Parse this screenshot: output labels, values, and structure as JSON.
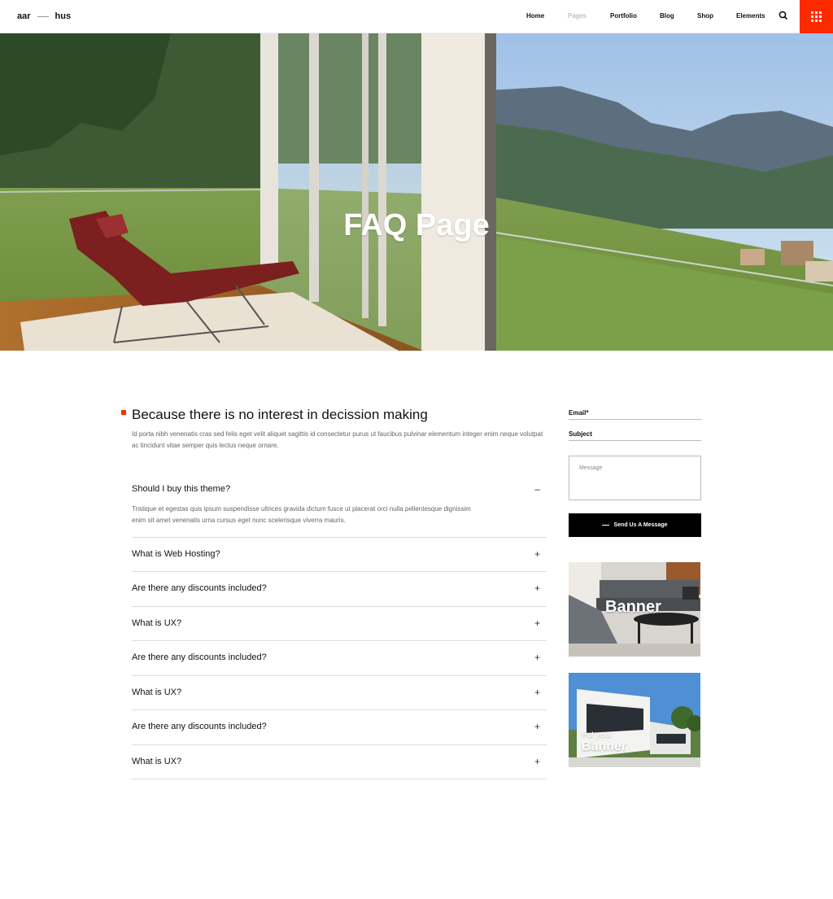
{
  "header": {
    "logo_left": "aar",
    "logo_right": "hus",
    "nav": [
      "Home",
      "Pages",
      "Portfolio",
      "Blog",
      "Shop",
      "Elements"
    ],
    "active_nav": "Pages",
    "accent": "#ff2a00"
  },
  "hero": {
    "title": "FAQ Page"
  },
  "main": {
    "title": "Because there is no interest in decission making",
    "intro": "Id porta nibh venenatis cras sed felis eget velit aliquet sagittis id consectetur purus ut faucibus pulvinar elementum integer enim neque volutpat ac tincidunt vitae semper quis lectus neque ornare.",
    "faqs": [
      {
        "q": "Should I buy this theme?",
        "a": "Tristique et egestas quis ipsum suspendisse ultrices gravida dictum fusce ut placerat orci nulla pellentesque dignissim enim sit amet venenatis urna cursus eget nunc scelerisque viverra mauris.",
        "toggle": "–",
        "open": true
      },
      {
        "q": "What is Web Hosting?",
        "toggle": "+"
      },
      {
        "q": "Are there any discounts included?",
        "toggle": "+"
      },
      {
        "q": "What is UX?",
        "toggle": "+"
      },
      {
        "q": "Are there any discounts included?",
        "toggle": "+"
      },
      {
        "q": "What is UX?",
        "toggle": "+"
      },
      {
        "q": "Are there any discounts included?",
        "toggle": "+"
      },
      {
        "q": "What is UX?",
        "toggle": "+"
      }
    ]
  },
  "sidebar": {
    "email_label": "Email*",
    "subject_label": "Subject",
    "message_placeholder": "Message",
    "send_label": "Send Us A Message",
    "banner1_text": "Banner",
    "banner2_small": "Put your",
    "banner2_text": "Banner"
  }
}
